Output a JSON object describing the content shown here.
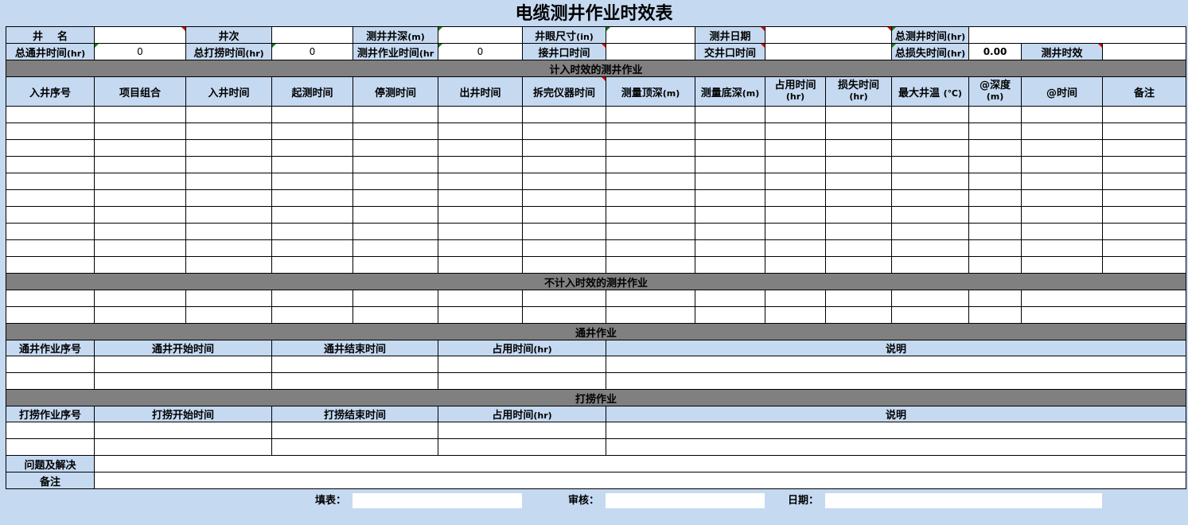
{
  "title": "电缆测井作业时效表",
  "info": {
    "well_name": "井    名",
    "run": "井次",
    "log_depth": "测井井深",
    "log_depth_unit": "(m)",
    "hole_size": "井眼尺寸",
    "hole_size_unit": "(in)",
    "log_date": "测井日期",
    "total_log_time": "总测井时间",
    "total_log_time_unit": "(hr)",
    "total_clean_time": "总通井时间",
    "total_clean_time_unit": "(hr)",
    "total_clean_value": "0",
    "total_fish_time": "总打捞时间",
    "total_fish_time_unit": "(hr)",
    "total_fish_value": "0",
    "log_work_time": "测井作业时间",
    "log_work_time_unit": "(hr",
    "log_work_value": "0",
    "receive_well_time": "接井口时间",
    "handover_time": "交井口时间",
    "total_loss_time": "总损失时间",
    "total_loss_time_unit": "(hr)",
    "total_loss_value": "0.00",
    "efficiency": "测井时效"
  },
  "sections": {
    "counted": "计入时效的测井作业",
    "not_counted": "不计入时效的测井作业",
    "clean": "通井作业",
    "fish": "打捞作业"
  },
  "columns": [
    {
      "label": "入井序号"
    },
    {
      "label": "项目组合"
    },
    {
      "label": "入井时间"
    },
    {
      "label": "起测时间"
    },
    {
      "label": "停测时间"
    },
    {
      "label": "出井时间"
    },
    {
      "label": "拆完仪器时间"
    },
    {
      "label": "测量顶深",
      "unit": "(m)"
    },
    {
      "label": "测量底深",
      "unit": "(m)"
    },
    {
      "label": "占用时间",
      "unit": "(hr)"
    },
    {
      "label": "损失时间",
      "unit": "(hr)"
    },
    {
      "label": "最大井温",
      "unit": "(℃)"
    },
    {
      "label": "@深度",
      "unit": "(m)"
    },
    {
      "label": "@时间"
    },
    {
      "label": "备注"
    }
  ],
  "clean_columns": {
    "seq": "通井作业序号",
    "start": "通井开始时间",
    "end": "通井结束时间",
    "used": "占用时间",
    "used_unit": "(hr)",
    "note": "说明"
  },
  "fish_columns": {
    "seq": "打捞作业序号",
    "start": "打捞开始时间",
    "end": "打捞结束时间",
    "used": "占用时间",
    "used_unit": "(hr)",
    "note": "说明"
  },
  "problems_label": "问题及解决",
  "remarks_label": "备注",
  "footer": {
    "filler": "填表：",
    "reviewer": "审核：",
    "date": "日期："
  }
}
